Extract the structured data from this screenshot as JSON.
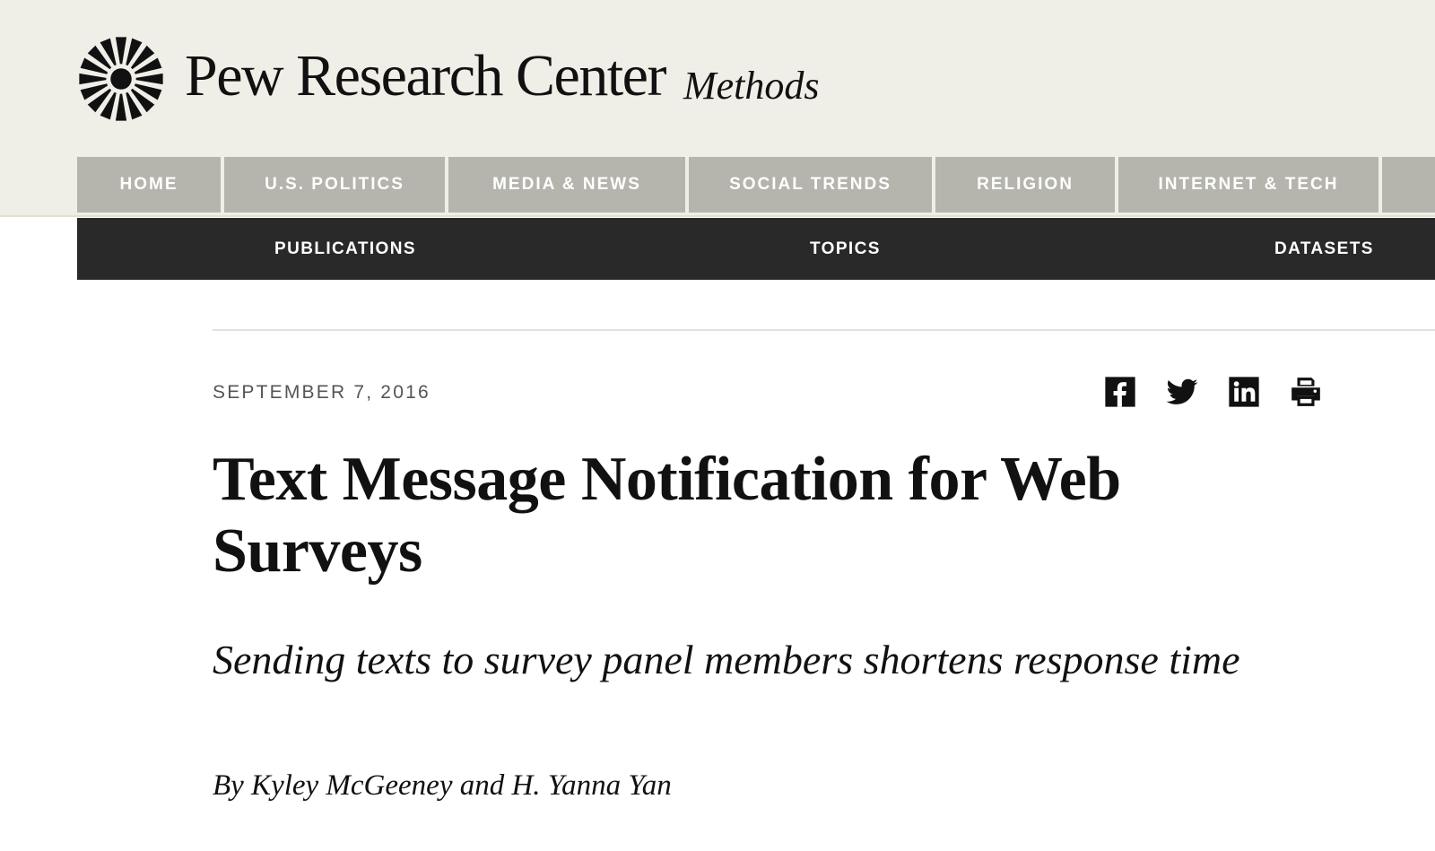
{
  "header": {
    "brand": "Pew Research Center",
    "section": "Methods",
    "logo_icon": "sunburst-logo-icon"
  },
  "primary_nav": [
    {
      "label": "HOME"
    },
    {
      "label": "U.S. POLITICS"
    },
    {
      "label": "MEDIA & NEWS"
    },
    {
      "label": "SOCIAL TRENDS"
    },
    {
      "label": "RELIGION"
    },
    {
      "label": "INTERNET & TECH"
    }
  ],
  "secondary_nav": [
    {
      "label": "PUBLICATIONS"
    },
    {
      "label": "TOPICS"
    },
    {
      "label": "DATASETS"
    }
  ],
  "article": {
    "date": "SEPTEMBER 7, 2016",
    "title": "Text Message Notification for Web Surveys",
    "subtitle": "Sending texts to survey panel members shortens response time",
    "byline": "By Kyley McGeeney and H. Yanna Yan"
  },
  "share_icons": [
    "facebook-icon",
    "twitter-icon",
    "linkedin-icon",
    "print-icon"
  ],
  "colors": {
    "masthead_bg": "#efeee7",
    "nav_tab_bg": "#b5b5ad",
    "secondary_nav_bg": "#292929",
    "text": "#111111"
  }
}
